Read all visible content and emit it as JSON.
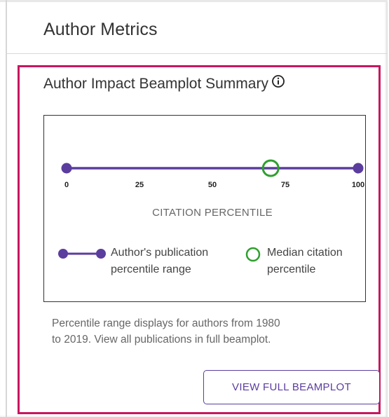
{
  "header": {
    "title": "Author Metrics"
  },
  "card": {
    "title": "Author Impact Beamplot Summary",
    "info_icon": "info-circle-icon"
  },
  "chart_data": {
    "type": "beamplot-range",
    "xlabel": "CITATION PERCENTILE",
    "ticks": [
      "0",
      "25",
      "50",
      "75",
      "100"
    ],
    "tick_values": [
      0,
      25,
      50,
      75,
      100
    ],
    "xlim": [
      0,
      100
    ],
    "range": {
      "min": 0,
      "max": 100
    },
    "median": 70,
    "range_color": "#5b3d9e",
    "median_color": "#2ea02e"
  },
  "legend": {
    "range_label_line1": "Author's publication",
    "range_label_line2": "percentile range",
    "median_label_line1": "Median citation",
    "median_label_line2": "percentile"
  },
  "note": {
    "line1": "Percentile range displays for authors from 1980",
    "line2": "to 2019. View all publications in full beamplot."
  },
  "button": {
    "label": "VIEW FULL BEAMPLOT",
    "accent": "#5b3d9e"
  },
  "colors": {
    "card_border": "#c8175f"
  }
}
